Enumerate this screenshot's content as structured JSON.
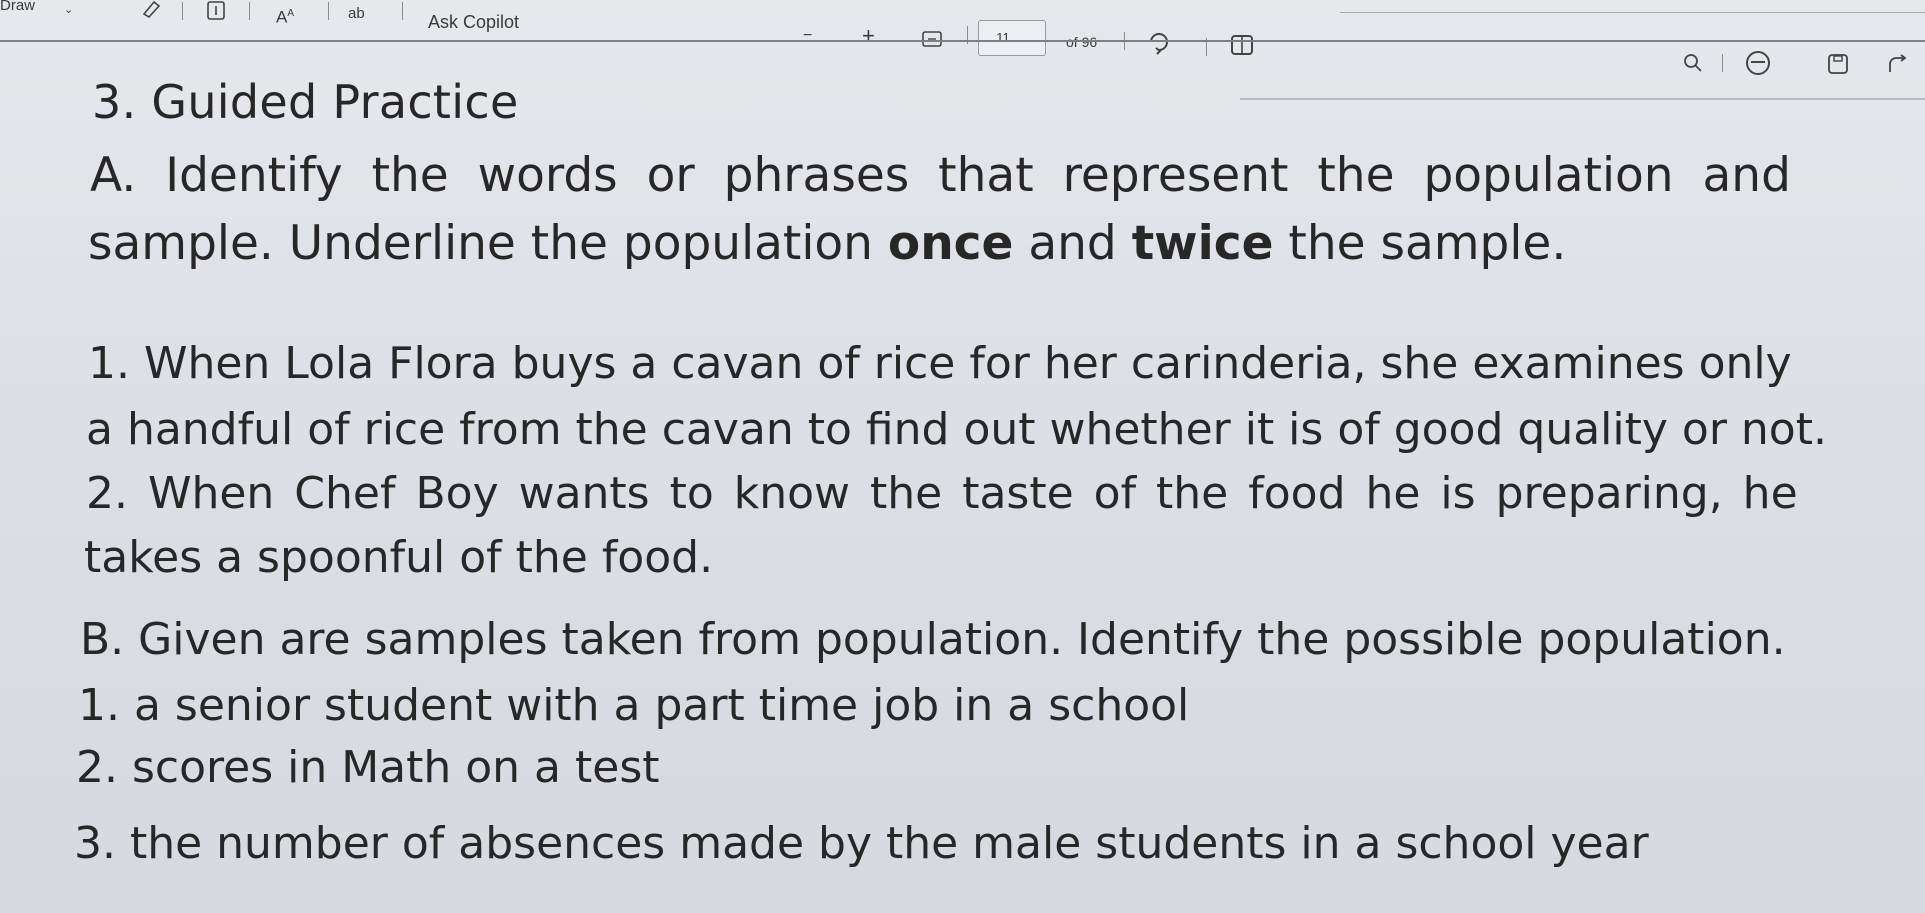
{
  "toolbar": {
    "draw_label": "Draw",
    "font_size_label": "A",
    "translate_label": "ab",
    "ask_copilot_label": "Ask Copilot",
    "zoom_out_label": "−",
    "zoom_in_label": "+",
    "page_number": "11",
    "page_total_label": "of 96"
  },
  "document": {
    "heading": "3. Guided Practice",
    "section_a": {
      "line1": "A. Identify the words or phrases that represent the population and",
      "line2_part1": "sample. Underline the population ",
      "line2_bold1": "once",
      "line2_part2": " and ",
      "line2_bold2": "twice",
      "line2_part3": " the sample.",
      "items": [
        "1. When  Lola Flora buys a cavan of rice for her carinderia, she examines only",
        "a handful of rice from the cavan to find out whether it is of good quality or not.",
        "2. When Chef Boy wants to know the taste of the food he is preparing, he",
        "takes a spoonful of the food."
      ]
    },
    "section_b": {
      "line1": "B. Given are samples taken from population. Identify the possible population.",
      "items": [
        "1. a senior student with a part time job in a school",
        "2. scores in Math on a test",
        "3. the number of absences made by the male students in a school year"
      ]
    }
  }
}
